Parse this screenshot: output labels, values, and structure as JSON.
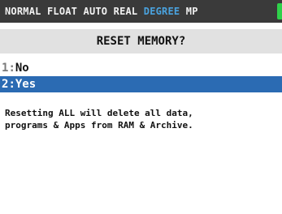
{
  "status_bar": {
    "modes_before": "NORMAL FLOAT AUTO REAL ",
    "angle_mode": "DEGREE",
    "modes_after": " MP",
    "battery_color": "#2fd14a"
  },
  "dialog": {
    "title": "RESET MEMORY?",
    "options": [
      {
        "number": "1",
        "separator": ":",
        "label": "No",
        "selected": false
      },
      {
        "number": "2",
        "separator": ":",
        "label": "Yes",
        "selected": true
      }
    ],
    "message_lines": [
      "Resetting ALL will delete all data,",
      "programs & Apps from RAM & Archive."
    ]
  },
  "colors": {
    "status_bg": "#3a3a3a",
    "highlight_text": "#4aa3df",
    "title_bg": "#e1e1e1",
    "selection_bg": "#2b6bb3"
  }
}
